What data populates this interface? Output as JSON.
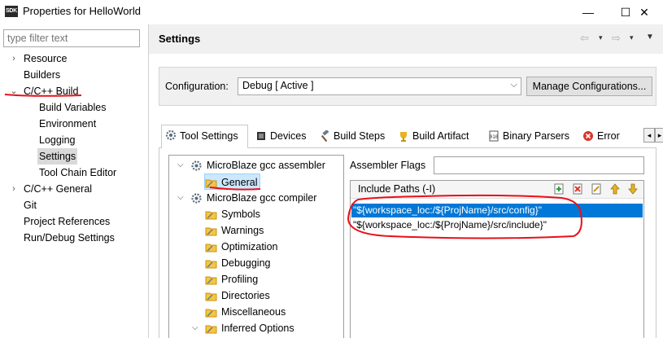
{
  "window": {
    "app_icon_text": "SDK",
    "title": "Properties for HelloWorld",
    "min_glyph": "—",
    "max_glyph": "☐",
    "close_glyph": "✕"
  },
  "left": {
    "filter_placeholder": "type filter text",
    "items": [
      {
        "label": "Resource",
        "arrow": "›"
      },
      {
        "label": "Builders"
      },
      {
        "label": "C/C++ Build",
        "arrow": "⌄"
      },
      {
        "label": "Build Variables"
      },
      {
        "label": "Environment"
      },
      {
        "label": "Logging"
      },
      {
        "label": "Settings"
      },
      {
        "label": "Tool Chain Editor"
      },
      {
        "label": "C/C++ General",
        "arrow": "›"
      },
      {
        "label": "Git"
      },
      {
        "label": "Project References"
      },
      {
        "label": "Run/Debug Settings"
      }
    ]
  },
  "header": {
    "title": "Settings",
    "back_glyph": "⇦",
    "fwd_glyph": "⇨",
    "dropdown_glyph": "▾",
    "menu_glyph": "▼"
  },
  "config": {
    "label": "Configuration:",
    "value": "Debug  [ Active ]",
    "dropdown_glyph": "⌵",
    "manage_label": "Manage Configurations..."
  },
  "tabs": [
    {
      "label": "Tool Settings",
      "active": true
    },
    {
      "label": "Devices"
    },
    {
      "label": "Build Steps"
    },
    {
      "label": "Build Artifact"
    },
    {
      "label": "Binary Parsers"
    },
    {
      "label": "Error"
    }
  ],
  "tab_scroll": {
    "left": "◂",
    "right": "▸"
  },
  "tool_tree": [
    {
      "label": "MicroBlaze gcc assembler",
      "twisty": "⌵"
    },
    {
      "label": "General",
      "selected": true
    },
    {
      "label": "MicroBlaze gcc compiler",
      "twisty": "⌵"
    },
    {
      "label": "Symbols"
    },
    {
      "label": "Warnings"
    },
    {
      "label": "Optimization"
    },
    {
      "label": "Debugging"
    },
    {
      "label": "Profiling"
    },
    {
      "label": "Directories"
    },
    {
      "label": "Miscellaneous"
    },
    {
      "label": "Inferred Options",
      "twisty": "⌵"
    }
  ],
  "assembler": {
    "flags_label": "Assembler Flags",
    "flags_value": "",
    "paths_title": "Include Paths (-I)",
    "paths": [
      {
        "value": "\"${workspace_loc:/${ProjName}/src/config}\"",
        "selected": true
      },
      {
        "value": "\"${workspace_loc:/${ProjName}/src/include}\""
      }
    ]
  },
  "colors": {
    "selection_blue": "#0078d7",
    "annotation_red": "#e8101a",
    "folder_yellow": "#f5c542",
    "gear_gray": "#5a6a7a"
  }
}
